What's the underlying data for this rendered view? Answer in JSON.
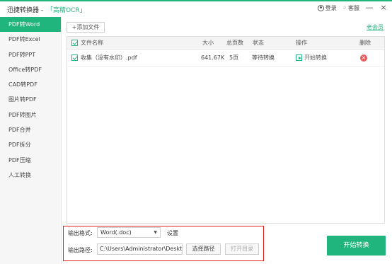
{
  "titlebar": {
    "app_name": "迅捷转换器 - ",
    "ocr_link": "「高精OCR」",
    "login_label": "登录",
    "service_label": "客服",
    "minimize": "—",
    "close": "×"
  },
  "sidebar": {
    "items": [
      {
        "label": "PDF转Word",
        "active": true
      },
      {
        "label": "PDF转Excel"
      },
      {
        "label": "PDF转PPT"
      },
      {
        "label": "Office转PDF"
      },
      {
        "label": "CAD转PDF"
      },
      {
        "label": "图片转PDF"
      },
      {
        "label": "PDF转图片"
      },
      {
        "label": "PDF合并"
      },
      {
        "label": "PDF拆分"
      },
      {
        "label": "PDF压缩"
      },
      {
        "label": "人工转换"
      }
    ]
  },
  "toolbar": {
    "add_file": "+添加文件",
    "vip": "老会员"
  },
  "table": {
    "headers": {
      "name": "文件名称",
      "size": "大小",
      "pages": "总页数",
      "status": "状态",
      "action": "操作",
      "delete": "删除"
    },
    "rows": [
      {
        "name": "收集（没有水印）.pdf",
        "size": "641.67K",
        "pages": "5页",
        "status": "等待转换",
        "action": "开始转换",
        "delete": "×"
      }
    ]
  },
  "output": {
    "format_label": "输出格式:",
    "format_value": "Word(.doc)",
    "caret": "▼",
    "settings": "设置",
    "path_label": "输出路径:",
    "path_value": "C:\\Users\\Administrator\\Desktop",
    "choose_path": "选择路径",
    "open_dir": "打开目录"
  },
  "start_button": "开始转换",
  "colors": {
    "accent": "#1fb57c",
    "highlight": "#e02020",
    "danger": "#e85c5c"
  }
}
